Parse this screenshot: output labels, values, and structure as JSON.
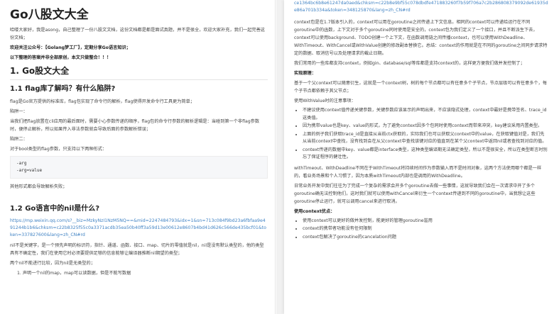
{
  "left": {
    "title": "Go八股文大全",
    "intro": "哈喽大家好，我是asong，自己整理了一份八股文文档，这份文档都是都是面试真题，并不是很全，欢迎大家补充，我们一起完善这份文档；",
    "welcome": "欢迎关注公众号：【Golang梦工厂】，定期分享Go语言知识；",
    "notice": "以下整理的答案并非全部原创，本文只做整合！！！",
    "section1": "1. Go股文大全",
    "q1_title": "1.1 flag库了解吗？有什么陷阱?",
    "q1_p1": "flag是Go官方提供的标准库，flag包实现了命令行的解析，flag使得开发命令行工具更为简单；",
    "q1_trap": "陷阱一：",
    "q1_p2": "当我们把flag放置在cli应用的最后面时，需要小心参数传递的顺序，flag包的命令行参数的解析逻辑是：当碰到第一个非flag参数时，便停止解析，所以如果传入非法参数就会导致后面的参数解析错误；",
    "q1_trap2": "陷阱二：",
    "q1_p3": "对于bool类型的flag参数，只支持以下两种形式：",
    "code_lines": [
      "-arg",
      "-arg=value"
    ],
    "q1_p4": "其他形式都会导致解析失败；",
    "q2_title": "1.2 Go语言中的nil是什么?",
    "q2_link": "https://mp.weixin.qq.com/s?__biz=MzkyNzI1NzM5NQ==&mid=2247484793&idx=1&sn=713c084f9bd23a6fbfaa9e491244b1b6&chksm=c22b8325f55c0a3371acdb35ea50b40ff3a59d13e00612e8607b4bd41d626c566de435bcf01&token=337827600&lang=zh_CN#rd",
    "q2_p1": "nil不是关键字，是一个预先声明的标识符，指针、通道、函数、接口、map、切片的零值就是nil，nil是没有默认类型的，他的类型具有不确定性，我们在使用它时必须要提供足够的信息能够让编译器推断nil期望的类型；",
    "q2_p2": "两个nil不能进行比较，因为nil是无类型的；",
    "q2_item1": "1. 声明一个nil的map，map可以读数据，但是不能写数据"
  },
  "right": {
    "link_tail": "ce1364bc6b8e61247da0aed&chksm=c22b8e9bf55c078dbdfe471883260f7b59f706a7c2b286808379092de61935de86a701b334a&token=348125870&lang=zh_CN#rd",
    "p1": "context包是在1.7版本引入的，context可以用在goroutine之间传递上下文信息。相同的context可以传递给运行在不同goroutine中的函数，上下文对于多个goroutine同时使用是安全的，context包为我们定义了一个接口，并且不断派生下去，context可以使用background、TODO创建一个上下文，在函数调用链之间传播context，也可以使用WithDeadline、WithTimeout、WithCancel或WithValue创建的修改副本替换它。总结：context的作用就是在不同的goroutine之间同步请求特定的数据、取消信号以及处理请求的截止日期。",
    "p2": "我们常用的一些库都支持context，例如gin、database/sql等库都是支持context的，这样更方便我们做并发控制了；",
    "impl_label": "实现原理：",
    "p3": "基于一个父context可以随意衍生，这就是一个context树，树的每个节点都可以有任意多个子节点，节点层级可以有任意多个，每个子节点都依赖于其父节点；",
    "p4": "使用WithValue时的注意事项：",
    "bullets": [
      "不建议使用context值传递关键参数，关键参数应该显示的声明出来，不应该隐式处理，context中最好是携带签名、trace_id这类值。",
      "因为携带value也是key、value的形式，为了避免context因多个包同时使用context而带来冲突，key建议采用内置类型。",
      "上面的例子我们获取trace_id是直接从当前ctx获取的，实际我们也可以获取父context中的value，在获取键值对是，我们先从当前context中查找，没有找到会在从父context中查找该键对应的值直到在某个父context中返回nil或者查找到对应的值。",
      "context传递的数据中key、value都是interface类型，这种类型编译期无法确定类型，所以不是很安全，所以在类型断言时别忘了保证程序的健壮性。"
    ],
    "p5": "withTimeout、WithDeadline不同在于WithTimeout将持续时间作为参数输入而不是时间对象，这两个方法使用哪个都是一样的，看业务场景和个人习惯了，因为本质withTimeout内部也是调用的WithDeadline。",
    "p6": "日常业务开发中我们往往为了完成一个复杂的需求会开多个goroutine去做一些事情，这就导致我们会在一次请求中开了多个goroutine确无法控制他们，这时我们就可以使用withCancel来衍生一个context传递到不同的goroutine中，当我想让这些goroutine停止运行，就可以调用cancel来进行取消。",
    "adv_label": "使用context优点：",
    "adv_items": [
      "使用context可以更好的做并发控制，能更好的管理goroutine滥用",
      "context的携带者功能没有任何限制",
      "context包解决了goroutine的cancelation问题"
    ]
  }
}
